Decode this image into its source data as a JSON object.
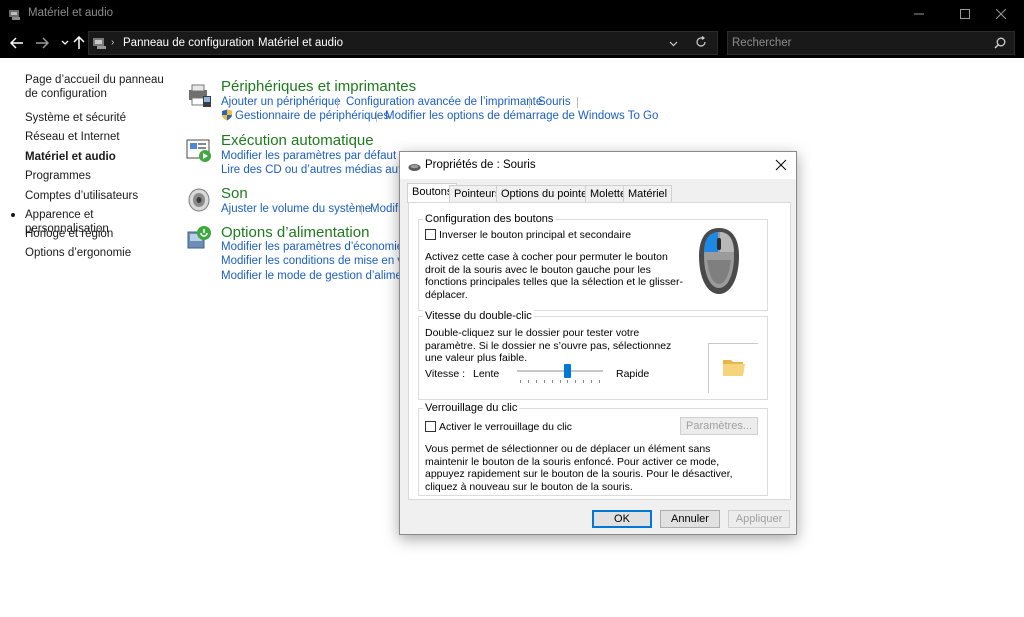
{
  "window": {
    "title": "Matériel et audio",
    "minimize_glyph": "—",
    "maximize_glyph": "☐",
    "close_glyph": "✕"
  },
  "address_bar": {
    "breadcrumbs": [
      "Panneau de configuration",
      "Matériel et audio"
    ],
    "search_placeholder": "Rechercher"
  },
  "sidebar": {
    "items": [
      {
        "label": "Page d’accueil du panneau de configuration"
      },
      {
        "label": "Système et sécurité"
      },
      {
        "label": "Réseau et Internet"
      },
      {
        "label": "Matériel et audio",
        "active": true
      },
      {
        "label": "Programmes"
      },
      {
        "label": "Comptes d’utilisateurs"
      },
      {
        "label": "Apparence et personnalisation"
      },
      {
        "label": "Horloge et région"
      },
      {
        "label": "Options d’ergonomie"
      }
    ]
  },
  "categories": {
    "devices": {
      "title": "Périphériques et imprimantes",
      "links": [
        "Ajouter un périphérique",
        "Configuration avancée de l’imprimante",
        "Souris",
        "Gestionnaire de périphériques",
        "Modifier les options de démarrage de Windows To Go"
      ]
    },
    "autoplay": {
      "title": "Exécution automatique",
      "links": [
        "Modifier les paramètres par défaut pour",
        "Lire des CD ou d’autres médias automat"
      ]
    },
    "sound": {
      "title": "Son",
      "links": [
        "Ajuster le volume du système",
        "Modifi"
      ]
    },
    "power": {
      "title": "Options d’alimentation",
      "links": [
        "Modifier les paramètres d’économie d’é",
        "Modifier les conditions de mise en veille",
        "Modifier le mode de gestion d’alimentat"
      ]
    }
  },
  "dialog": {
    "title": "Propriétés de : Souris",
    "tabs": [
      "Boutons",
      "Pointeurs",
      "Options du pointeur",
      "Molette",
      "Matériel"
    ],
    "selected_tab": "Boutons",
    "button_config": {
      "group_title": "Configuration des boutons",
      "checkbox_label": "Inverser le bouton principal et secondaire",
      "checked": false,
      "description": "Activez cette case à cocher pour permuter le bouton droit de la souris avec le bouton gauche pour les fonctions principales telles que la sélection et le glisser-déplacer."
    },
    "double_click": {
      "group_title": "Vitesse du double-clic",
      "description": "Double-cliquez sur le dossier pour tester votre paramètre. Si le dossier ne s’ouvre pas, sélectionnez une valeur plus faible.",
      "speed_label": "Vitesse :",
      "slow_label": "Lente",
      "fast_label": "Rapide",
      "slider_level": 0.6
    },
    "click_lock": {
      "group_title": "Verrouillage du clic",
      "checkbox_label": "Activer le verrouillage du clic",
      "checked": false,
      "settings_button": "Paramètres...",
      "description": "Vous permet de sélectionner ou de déplacer un élément sans maintenir le bouton de la souris enfoncé. Pour activer ce mode, appuyez rapidement sur le bouton de la souris. Pour le désactiver, cliquez à nouveau sur le bouton de la souris."
    },
    "buttons": {
      "ok": "OK",
      "cancel": "Annuler",
      "apply": "Appliquer"
    }
  },
  "colors": {
    "link": "#1c5fc0",
    "category_title": "#1e7a1e",
    "accent": "#0078d7",
    "chrome": "#000000"
  }
}
